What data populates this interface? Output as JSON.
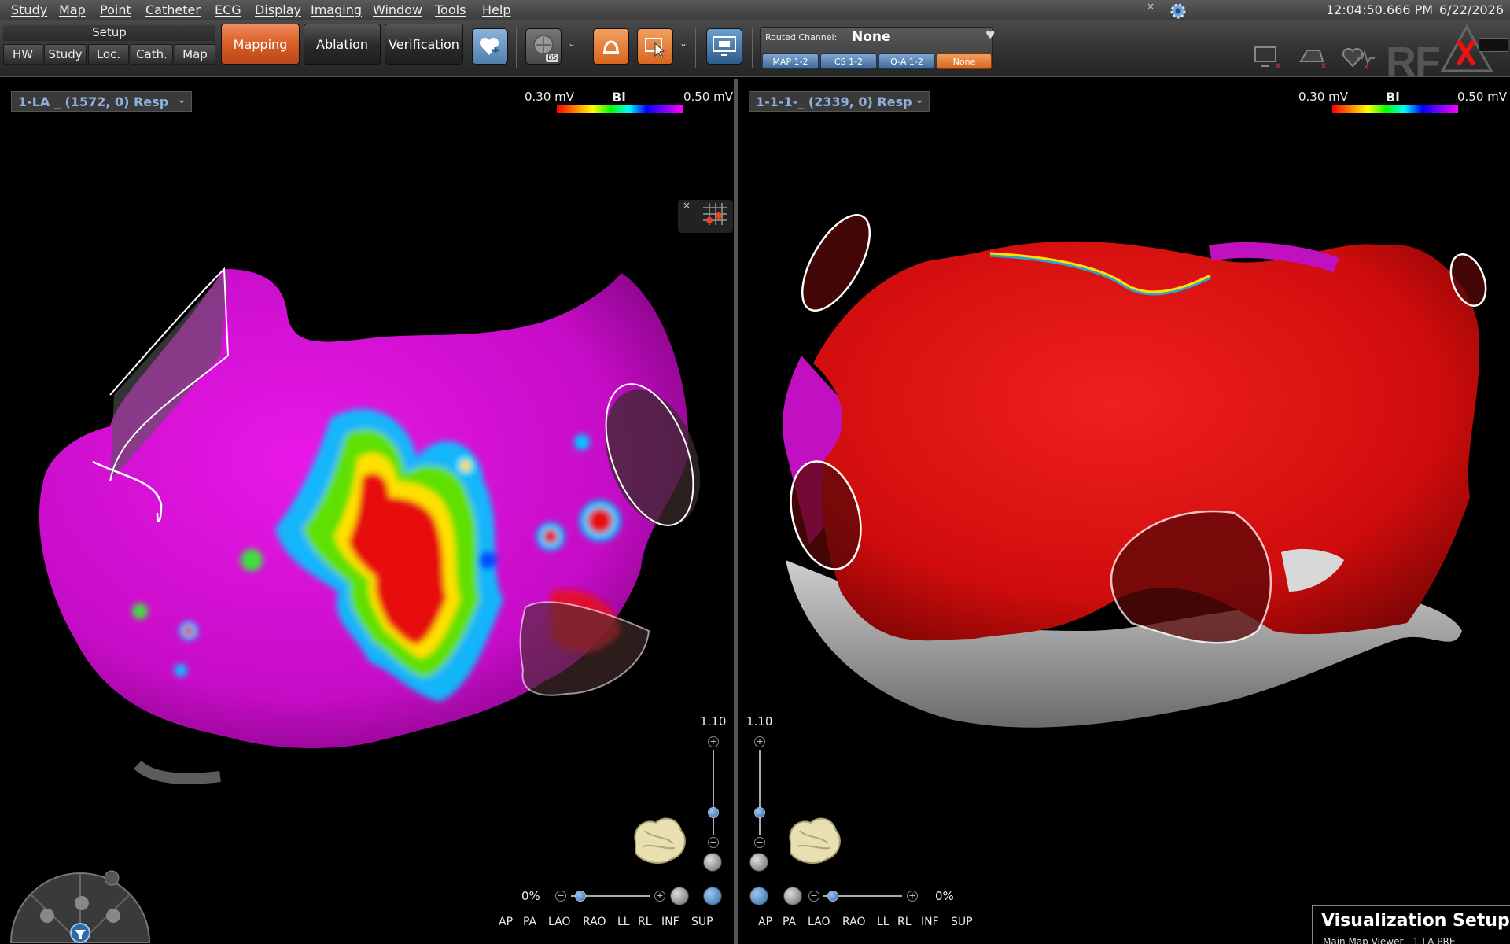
{
  "menu": {
    "items": [
      "Study",
      "Map",
      "Point",
      "Catheter",
      "ECG",
      "Display",
      "Imaging",
      "Window",
      "Tools",
      "Help"
    ],
    "time": "12:04:50.666 PM",
    "date": "6/22/2026"
  },
  "toolbar": {
    "setup_label": "Setup",
    "setup_buttons": [
      "HW",
      "Study",
      "Loc.",
      "Cath.",
      "Map"
    ],
    "modes": [
      "Mapping",
      "Ablation",
      "Verification"
    ],
    "active_mode": "Mapping",
    "bs_badge": "BS",
    "routed_channel_label": "Routed Channel:",
    "routed_channel_value": "None",
    "channels": [
      "MAP 1-2",
      "CS 1-2",
      "Q-A 1-2",
      "None"
    ],
    "rf_label": "RF"
  },
  "left_view": {
    "map_name": "1-LA _ (1572, 0) Resp",
    "scale_min": "0.30 mV",
    "scale_title": "Bi",
    "scale_max": "0.50 mV",
    "zoom": "1.10",
    "zoom_level": 0.73,
    "transparency": "0%"
  },
  "right_view": {
    "map_name": "1-1-1-_ (2339, 0) Resp",
    "scale_min": "0.30 mV",
    "scale_title": "Bi",
    "scale_max": "0.50 mV",
    "zoom": "1.10",
    "zoom_level": 0.73,
    "transparency": "0%"
  },
  "view_buttons": [
    "AP",
    "PA",
    "LAO",
    "RAO",
    "LL",
    "RL",
    "INF",
    "SUP"
  ],
  "viz_panel": {
    "title": "Visualization Setup",
    "subtitle": "Main Map Viewer - 1-LA PRE"
  },
  "colors": {
    "accent_orange": "#d65a22",
    "map_magenta": "#e010e0",
    "map_red": "#e01010",
    "link_blue": "#8fb0dd"
  }
}
